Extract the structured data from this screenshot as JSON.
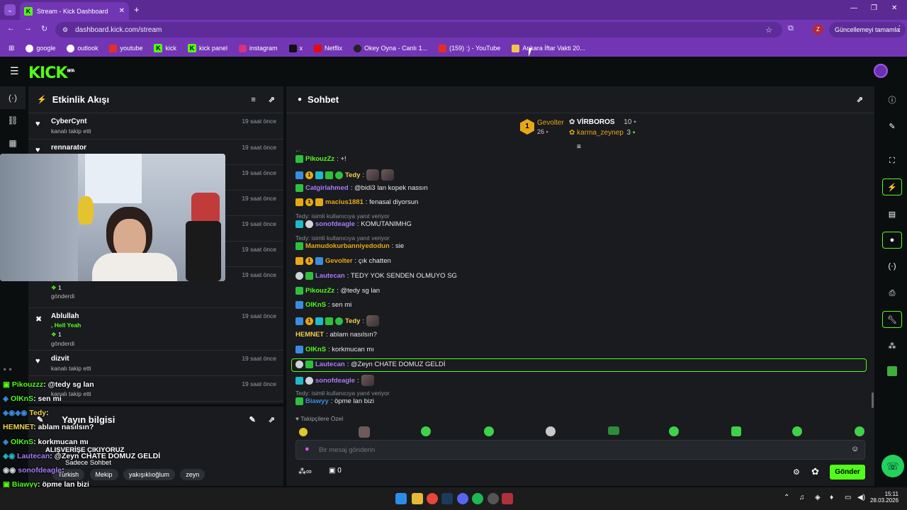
{
  "browser": {
    "tab_title": "Stream - Kick Dashboard",
    "url": "dashboard.kick.com/stream",
    "profile_initial": "Z",
    "update_label": "Güncellemeyi tamamla",
    "bookmarks": [
      "google",
      "outlook",
      "youtube",
      "kick",
      "kick panel",
      "instagram",
      "x",
      "Netflix",
      "Okey Oyna - Canlı 1...",
      "(159) :) - YouTube",
      "Ankara İftar Vakti 20..."
    ]
  },
  "kick": {
    "logo": "KICK",
    "beta": "BETA"
  },
  "activity": {
    "title": "Etkinlik Akışı",
    "items": [
      {
        "name": "CyberCynt",
        "sub": "kanalı takip etti",
        "time": "19 saat önce"
      },
      {
        "name": "rennarator",
        "sub": "",
        "time": "19 saat önce"
      },
      {
        "name": "",
        "sub": "",
        "time": "19 saat önce"
      },
      {
        "name": "",
        "sub": "",
        "time": "19 saat önce"
      },
      {
        "name": "",
        "sub": "",
        "time": "19 saat önce"
      },
      {
        "name": "",
        "sub": "",
        "time": "19 saat önce"
      },
      {
        "name": "",
        "sub": "",
        "time": "19 saat önce"
      },
      {
        "name": "Ablullah",
        "sub": "",
        "time": "19 saat önce"
      },
      {
        "name": "dizvit",
        "sub": "kanalı takip etti",
        "time": "19 saat önce"
      },
      {
        "name": "",
        "sub": "kanalı takip etti",
        "time": "19 saat önce"
      }
    ],
    "hell_yeah": ", Hell Yeah",
    "count": "1",
    "sent": "gönderdi"
  },
  "stream_info": {
    "title": "Yayın bilgisi",
    "stream_title": "ALIŞVERİŞE ÇIKIYORUZ",
    "mode": "Sadece Sohbet",
    "tags": [
      "Turkish",
      "Mekip",
      "yakışıklıoğlum",
      "zeyn"
    ]
  },
  "overlay_chat": [
    {
      "user": "Pikouzzz",
      "text": ": @tedy sg lan",
      "color": "#53fc18"
    },
    {
      "user": "OlKnS",
      "text": ": sen mi",
      "color": "#53fc18"
    },
    {
      "user": "Tedy",
      "text": ":",
      "color": "#f0d24a"
    },
    {
      "user": "HEMNET",
      "text": ": ablam nasılsın?",
      "color": "#f0d24a"
    },
    {
      "user": "OlKnS",
      "text": ": korkmucan mı",
      "color": "#53fc18"
    },
    {
      "user": "Lautecan",
      "text": ": @Zeyn CHATE DOMUZ GELDİ",
      "color": "#a77cf7"
    },
    {
      "user": "sonofdeagle",
      "text": ":",
      "color": "#a77cf7"
    },
    {
      "user": "Biawyy",
      "text": ": öpme lan bizi",
      "color": "#53fc18"
    }
  ],
  "chat": {
    "title": "Sohbet",
    "leaderboard": [
      {
        "rank": "1",
        "name": "Gevolter",
        "score": "26"
      },
      {
        "rank": "",
        "name": "VİRBOROS",
        "score": "10"
      },
      {
        "rank": "",
        "name": "karma_zeynep",
        "score": "3"
      }
    ],
    "messages": [
      {
        "user": "PikouzZz",
        "text": ": +!",
        "color": "#53fc18"
      },
      {
        "user": "Tedy",
        "text": ":",
        "color": "#f0d24a"
      },
      {
        "user": "Catgirlahmed",
        "text": ": @bidi3 lan kopek nassın",
        "color": "#a77cf7"
      },
      {
        "user": "macius1881",
        "text": ": fenasal diyorsun",
        "color": "#e6a817"
      },
      {
        "reply": "Tedy:     isimli kullanıcıya yanıt veriyor"
      },
      {
        "user": "sonofdeagle",
        "text": ": KOMUTANIMHG",
        "color": "#a77cf7"
      },
      {
        "reply": "Tedy:     isimli kullanıcıya yanıt veriyor"
      },
      {
        "user": "Mamudokurbanniyedodun",
        "text": ": sie",
        "color": "#e6a817"
      },
      {
        "user": "Gevolter",
        "text": ": çık chatten",
        "color": "#e6a817"
      },
      {
        "user": "Lautecan",
        "text": ": TEDY YOK SENDEN OLMUYO SG",
        "color": "#a77cf7"
      },
      {
        "user": "PikouzZz",
        "text": ": @tedy sg lan",
        "color": "#53fc18"
      },
      {
        "user": "OlKnS",
        "text": ": sen mi",
        "color": "#53fc18"
      },
      {
        "user": "Tedy",
        "text": ":",
        "color": "#f0d24a"
      },
      {
        "user": "HEMNET",
        "text": ": ablam nasılsın?",
        "color": "#f0d24a"
      },
      {
        "user": "OlKnS",
        "text": ": korkmucan mı",
        "color": "#53fc18"
      },
      {
        "user": "Lautecan",
        "text": ": @Zeyn CHATE DOMUZ GELDİ",
        "color": "#a77cf7"
      },
      {
        "user": "sonofdeagle",
        "text": ":",
        "color": "#a77cf7"
      },
      {
        "reply": "Tedy:     isimli kullanıcıya yanıt veriyor"
      },
      {
        "user": "Biawyy",
        "text": ": öpme lan bizi",
        "color": "#3a8dde"
      }
    ],
    "followers_only": "Takipçilere Özel",
    "input_placeholder": "Bir mesaj gönderin",
    "points": "0",
    "send_label": "Gönder"
  },
  "taskbar": {
    "time": "15:11",
    "date": "28.03.2026"
  }
}
